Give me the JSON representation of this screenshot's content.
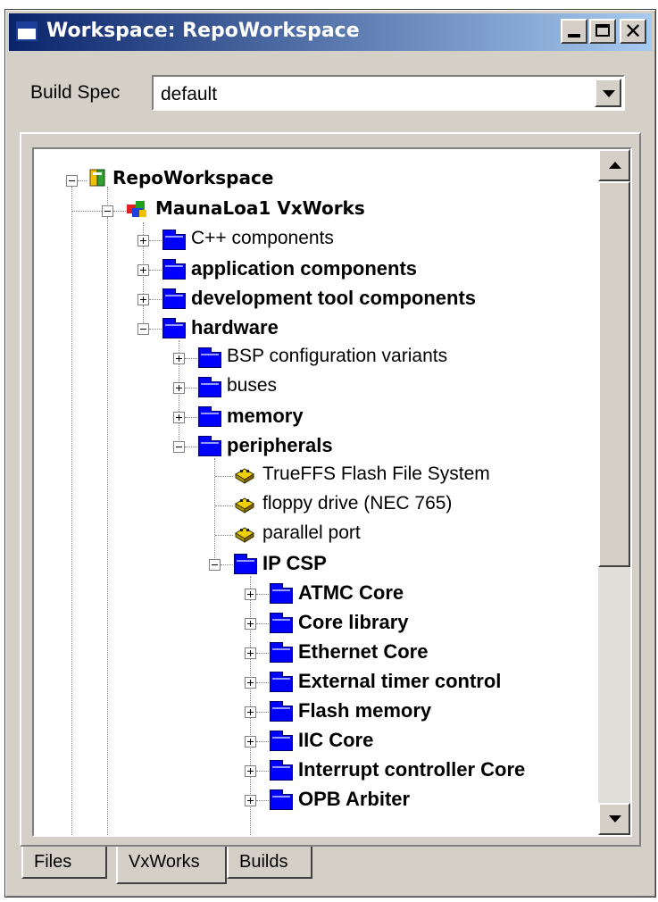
{
  "window": {
    "title": "Workspace: RepoWorkspace",
    "controls": {
      "minimize": "_",
      "maximize": "□",
      "close": "✕"
    }
  },
  "build_spec": {
    "label": "Build Spec",
    "value": "default"
  },
  "tree": {
    "root": "RepoWorkspace",
    "project": "MaunaLoa1 VxWorks",
    "nodes": [
      {
        "label": "C++ components",
        "bold": false
      },
      {
        "label": "application components",
        "bold": true
      },
      {
        "label": "development tool components",
        "bold": true
      },
      {
        "label": "hardware",
        "bold": true
      },
      {
        "label": "BSP configuration variants",
        "bold": false
      },
      {
        "label": "buses",
        "bold": false
      },
      {
        "label": "memory",
        "bold": true
      },
      {
        "label": "peripherals",
        "bold": true
      },
      {
        "label": "TrueFFS Flash File System",
        "bold": false
      },
      {
        "label": "floppy drive (NEC 765)",
        "bold": false
      },
      {
        "label": "parallel port",
        "bold": false
      },
      {
        "label": "IP CSP",
        "bold": true
      },
      {
        "label": "ATMC Core",
        "bold": true
      },
      {
        "label": "Core library",
        "bold": true
      },
      {
        "label": "Ethernet Core",
        "bold": true
      },
      {
        "label": "External timer control",
        "bold": true
      },
      {
        "label": "Flash memory",
        "bold": true
      },
      {
        "label": "IIC Core",
        "bold": true
      },
      {
        "label": "Interrupt controller Core",
        "bold": true
      },
      {
        "label": "OPB Arbiter",
        "bold": true
      }
    ]
  },
  "tabs": [
    "Files",
    "VxWorks",
    "Builds"
  ],
  "active_tab": "VxWorks",
  "colors": {
    "title_bar": "#0a246a",
    "folder": "#0000ff",
    "face": "#d4d0c8"
  }
}
